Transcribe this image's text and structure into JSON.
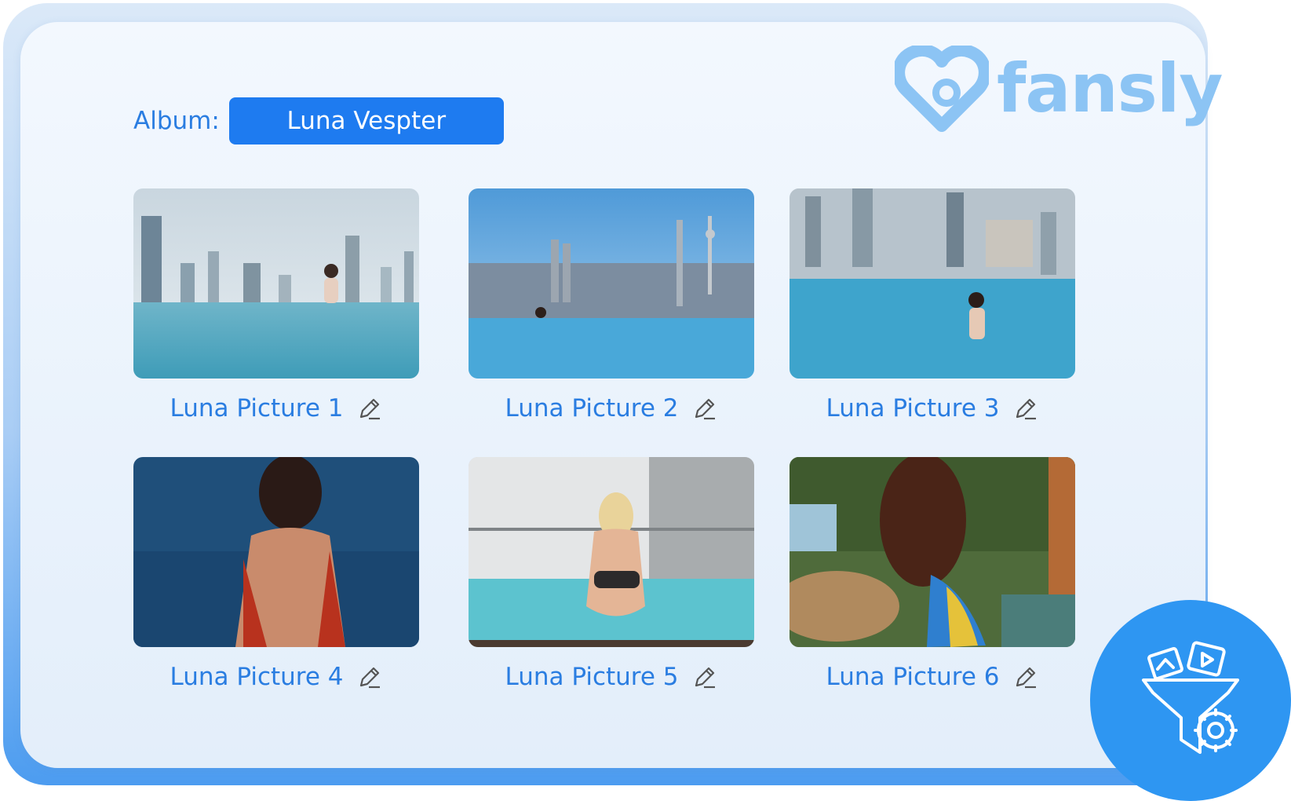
{
  "brand": {
    "name": "fansly",
    "color": "#8cc4f4"
  },
  "album": {
    "label": "Album:",
    "selected": "Luna Vespter"
  },
  "gallery": {
    "items": [
      {
        "caption": "Luna Picture 1"
      },
      {
        "caption": "Luna Picture 2"
      },
      {
        "caption": "Luna Picture 3"
      },
      {
        "caption": "Luna Picture 4"
      },
      {
        "caption": "Luna Picture 5"
      },
      {
        "caption": "Luna Picture 6"
      }
    ]
  },
  "colors": {
    "accent": "#1e7bf0",
    "text": "#2a7de1",
    "fab": "#2e96f2"
  },
  "icons": {
    "edit": "pencil-icon",
    "fab": "filter-funnel-gear-icon",
    "logo": "heart-camera-logo"
  }
}
